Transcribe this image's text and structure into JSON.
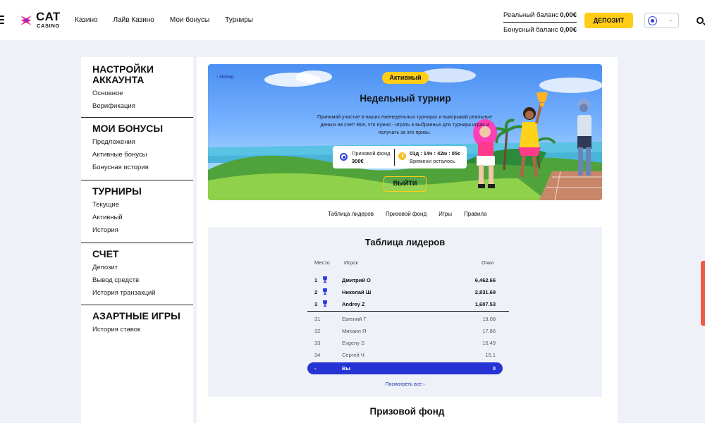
{
  "header": {
    "logo": {
      "top": "CAT",
      "bottom": "CASINO"
    },
    "nav": [
      "Казино",
      "Лайв Казино",
      "Мои бонусы",
      "Турниры"
    ],
    "balances": [
      {
        "label": "Реальный баланс",
        "value": "0,00€"
      },
      {
        "label": "Бонусный баланс",
        "value": "0,00€"
      }
    ],
    "deposit_label": "ДЕПОЗИТ",
    "icons": [
      "menu-icon",
      "flag-icon",
      "chevron-down-icon",
      "search-icon"
    ]
  },
  "sidebar": {
    "sections": [
      {
        "title": "НАСТРОЙКИ АККАУНТА",
        "items": [
          "Основное",
          "Верификация"
        ]
      },
      {
        "title": "МОИ БОНУСЫ",
        "items": [
          "Предложения",
          "Активные бонусы",
          "Бонусная история"
        ]
      },
      {
        "title": "ТУРНИРЫ",
        "items": [
          "Текущие",
          "Активный",
          "История"
        ]
      },
      {
        "title": "СЧЕТ",
        "items": [
          "Депозит",
          "Вывод средств",
          "История транзакций"
        ]
      },
      {
        "title": "АЗАРТНЫЕ ИГРЫ",
        "items": [
          "История ставок"
        ]
      }
    ]
  },
  "tournament": {
    "back": "Назад",
    "status": "Активный",
    "title": "Недельный турнир",
    "description": "Принимай участие в наших еженедельных турнирах и выигрывай реальные деньги на счет! Все, что нужно - играть в выбранных для турнира играх и получать за это призы.",
    "prize_label": "Призовой фонд",
    "prize_value": "300€",
    "timer": "01д : 14ч : 42м : 05с",
    "timer_label": "Времени осталось",
    "exit_label": "ВЫЙТИ"
  },
  "tabs": [
    "Таблица лидеров",
    "Призовой фонд",
    "Игры",
    "Правила"
  ],
  "leaderboard": {
    "title": "Таблица лидеров",
    "columns": {
      "place": "Место",
      "player": "Игрок",
      "points": "Очки"
    },
    "top": [
      {
        "place": "1",
        "player": "Дмитрий О",
        "points": "6,462.66"
      },
      {
        "place": "2",
        "player": "Николай Ш",
        "points": "2,831.69"
      },
      {
        "place": "3",
        "player": "Andrey Z",
        "points": "1,607.53"
      }
    ],
    "rest": [
      {
        "place": "31",
        "player": "Евгений Г",
        "points": "19.08"
      },
      {
        "place": "32",
        "player": "Михаил Я",
        "points": "17.86"
      },
      {
        "place": "33",
        "player": "Evgeny S",
        "points": "15.49"
      },
      {
        "place": "34",
        "player": "Сергей Ч",
        "points": "15.1"
      }
    ],
    "you": {
      "place": "-",
      "player": "Вы",
      "points": "0"
    },
    "see_all": "Посмотреть все"
  },
  "prize_section_title": "Призовой фонд",
  "colors": {
    "accent_yellow": "#ffcd16",
    "accent_blue": "#2734d4"
  }
}
